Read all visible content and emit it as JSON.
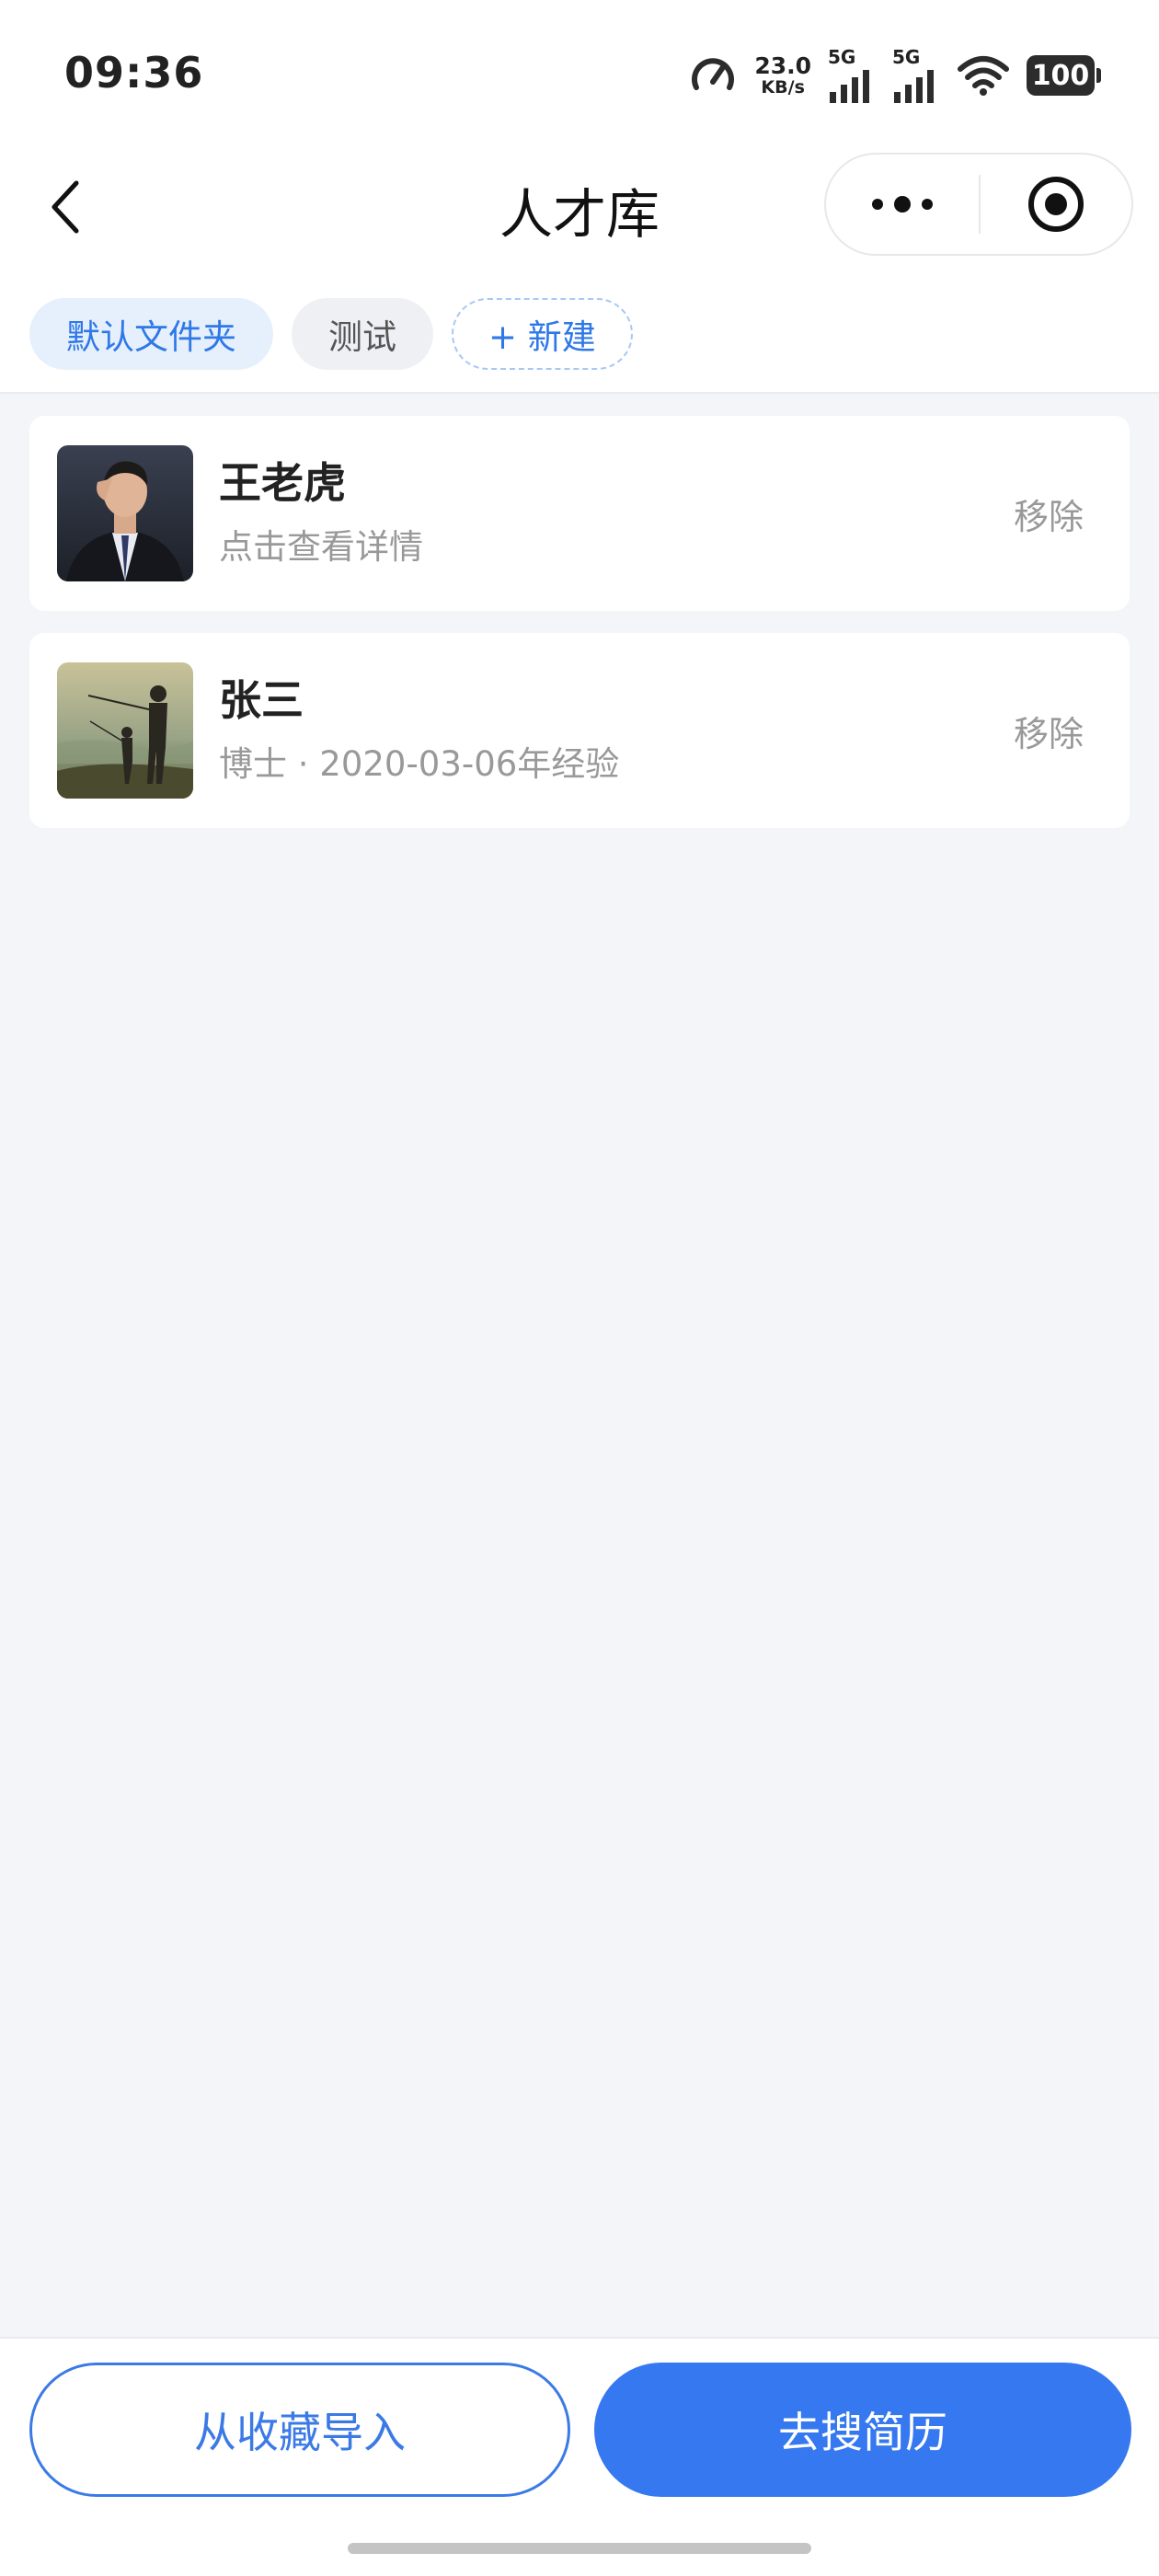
{
  "status_bar": {
    "time": "09:36",
    "speed_value": "23.0",
    "speed_unit": "KB/s",
    "sim1_label": "5G",
    "sim2_label": "5G",
    "battery": "100"
  },
  "nav": {
    "title": "人才库",
    "back_icon": "chevron-left-icon",
    "more_icon": "more-dots-icon",
    "close_icon": "target-circle-icon"
  },
  "folder_tabs": [
    {
      "label": "默认文件夹",
      "active": true
    },
    {
      "label": "测试",
      "active": false
    },
    {
      "label": "+ 新建",
      "active": false
    }
  ],
  "candidates": [
    {
      "name": "王老虎",
      "subtitle": "点击查看详情",
      "action": "移除",
      "avatar": "man-in-suit-photo"
    },
    {
      "name": "张三",
      "subtitle": "博士 · 2020-03-06年经验",
      "action": "移除",
      "avatar": "fishing-silhouette-photo"
    }
  ],
  "bottom": {
    "import_label": "从收藏导入",
    "search_label": "去搜简历"
  },
  "colors": {
    "accent": "#3578f0",
    "background": "#f3f5f9",
    "tab_active_bg": "#e6f0fd"
  }
}
